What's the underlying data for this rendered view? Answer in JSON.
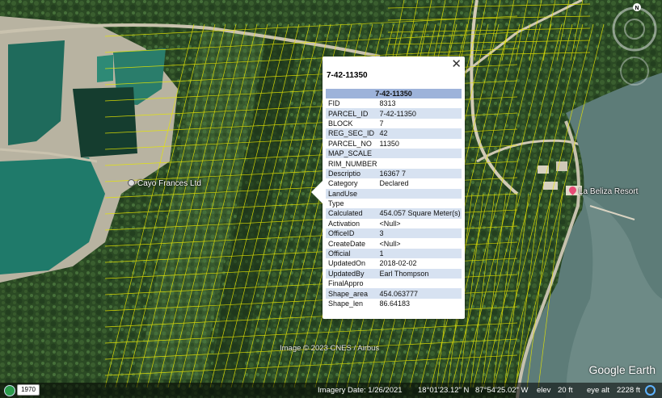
{
  "map": {
    "labels": {
      "cayo_frances": "Cayo Frances Ltd",
      "la_beliza": "La Beliza Resort"
    },
    "attribution": "Image © 2023 CNES / Airbus",
    "brand": "Google Earth",
    "compass_north": "N"
  },
  "popup": {
    "title": "7-42-11350",
    "table_header": "7-42-11350",
    "close_glyph": "✕",
    "rows": [
      {
        "key": "FID",
        "value": "8313"
      },
      {
        "key": "PARCEL_ID",
        "value": "7-42-11350"
      },
      {
        "key": "BLOCK",
        "value": "7"
      },
      {
        "key": "REG_SEC_ID",
        "value": "42"
      },
      {
        "key": "PARCEL_NO",
        "value": "11350"
      },
      {
        "key": "MAP_SCALE",
        "value": ""
      },
      {
        "key": "RIM_NUMBER",
        "value": ""
      },
      {
        "key": "Descriptio",
        "value": "16367 7"
      },
      {
        "key": "Category",
        "value": "Declared"
      },
      {
        "key": "LandUse",
        "value": ""
      },
      {
        "key": "Type",
        "value": ""
      },
      {
        "key": "Calculated",
        "value": "454.057 Square Meter(s)"
      },
      {
        "key": "Activation",
        "value": "<Null>"
      },
      {
        "key": "OfficeID",
        "value": "3"
      },
      {
        "key": "CreateDate",
        "value": "<Null>"
      },
      {
        "key": "Official",
        "value": "1"
      },
      {
        "key": "UpdatedOn",
        "value": "2018-02-02"
      },
      {
        "key": "UpdatedBy",
        "value": "Earl Thompson"
      },
      {
        "key": "FinalAppro",
        "value": ""
      },
      {
        "key": "Shape_area",
        "value": "454.063777"
      },
      {
        "key": "Shape_len",
        "value": "86.64183"
      }
    ]
  },
  "status": {
    "year": "1970",
    "imagery_date": "Imagery Date: 1/26/2021",
    "lat": "18°01'23.12\" N",
    "lon": "87°54'25.02\" W",
    "elev_label": "elev",
    "elev_value": "20 ft",
    "eye_label": "eye alt",
    "eye_value": "2228 ft"
  },
  "colors": {
    "parcel_lines": "#e6e600",
    "vegetation": "#2e4d27",
    "water_pond": "#1f6b5c",
    "sea": "#5d7c78",
    "sand": "#b8b3a1",
    "popup_header": "#9db3da",
    "popup_alt_row": "#d7e2f1"
  }
}
